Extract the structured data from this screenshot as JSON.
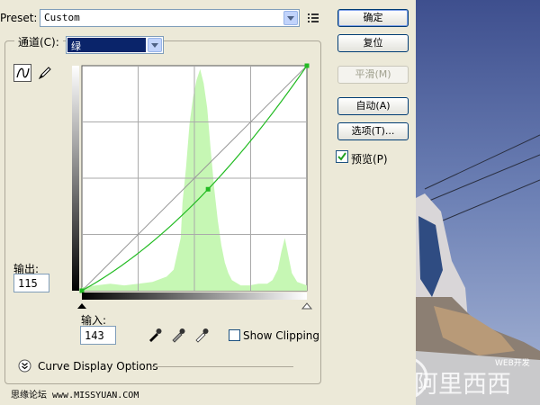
{
  "preset": {
    "label": "Preset:",
    "value": "Custom"
  },
  "buttons": {
    "ok": "确定",
    "reset": "复位",
    "smooth": "平滑(M)",
    "auto": "自动(A)",
    "options": "选项(T)..."
  },
  "preview": {
    "label": "预览(P)",
    "checked": true
  },
  "channel": {
    "label": "通道(C):",
    "value": "绿"
  },
  "output": {
    "label": "输出:",
    "value": "115"
  },
  "input": {
    "label": "输入:",
    "value": "143"
  },
  "show_clipping": {
    "label": "Show Clipping",
    "checked": false
  },
  "curve_display_options": "Curve Display Options",
  "watermarks": {
    "left": "思缘论坛  www.MISSYUAN.COM",
    "right_small": "WEB开发",
    "right_big": "阿里西西"
  },
  "colors": {
    "curve": "#22bb22",
    "histogram": "#c6f7b4",
    "channel_highlight": "#0a246a"
  },
  "chart_data": {
    "type": "line",
    "xlim": [
      0,
      255
    ],
    "ylim": [
      0,
      255
    ],
    "curve_points": [
      [
        0,
        0
      ],
      [
        143,
        115
      ],
      [
        255,
        255
      ]
    ],
    "histogram": [
      [
        0,
        2
      ],
      [
        16,
        3
      ],
      [
        32,
        4
      ],
      [
        48,
        3
      ],
      [
        64,
        4
      ],
      [
        80,
        5
      ],
      [
        96,
        8
      ],
      [
        104,
        12
      ],
      [
        112,
        30
      ],
      [
        114,
        50
      ],
      [
        118,
        70
      ],
      [
        122,
        95
      ],
      [
        126,
        110
      ],
      [
        130,
        120
      ],
      [
        134,
        126
      ],
      [
        138,
        118
      ],
      [
        142,
        104
      ],
      [
        146,
        80
      ],
      [
        150,
        58
      ],
      [
        154,
        40
      ],
      [
        158,
        26
      ],
      [
        162,
        16
      ],
      [
        166,
        10
      ],
      [
        170,
        6
      ],
      [
        180,
        3
      ],
      [
        190,
        3
      ],
      [
        200,
        4
      ],
      [
        210,
        4
      ],
      [
        216,
        6
      ],
      [
        222,
        12
      ],
      [
        226,
        22
      ],
      [
        230,
        30
      ],
      [
        234,
        20
      ],
      [
        238,
        10
      ],
      [
        244,
        5
      ],
      [
        255,
        3
      ]
    ]
  }
}
